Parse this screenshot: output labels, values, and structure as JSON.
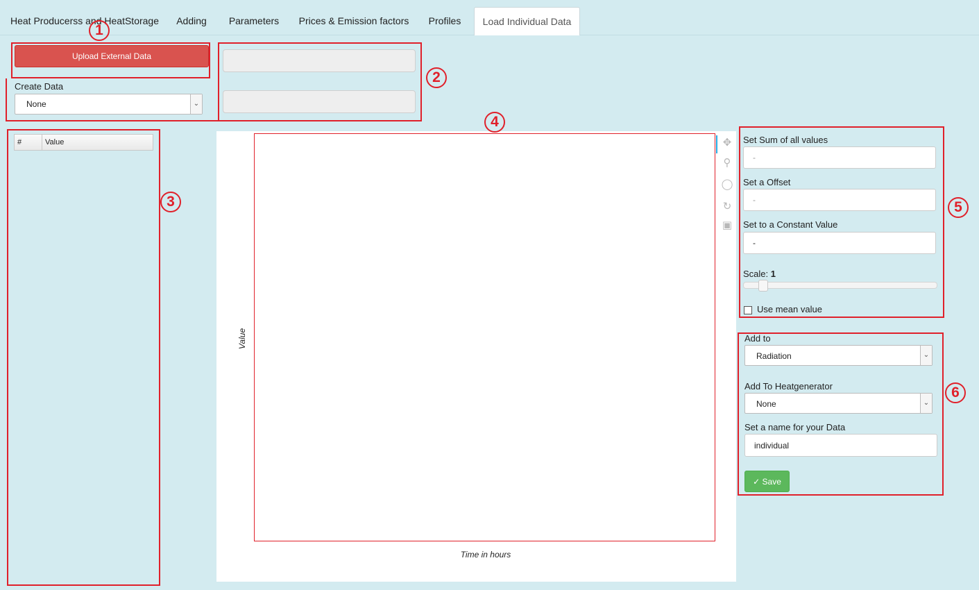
{
  "tabs": [
    {
      "label": "Heat Producerss and HeatStorage"
    },
    {
      "label": "Adding"
    },
    {
      "label": "Parameters"
    },
    {
      "label": "Prices & Emission factors"
    },
    {
      "label": "Profiles"
    },
    {
      "label": "Load Individual Data"
    }
  ],
  "upload": {
    "button_label": "Upload External Data"
  },
  "create": {
    "label": "Create Data",
    "selected": "None"
  },
  "table": {
    "headers": [
      "#",
      "Value"
    ]
  },
  "chart": {
    "ylabel": "Value",
    "xlabel": "Time in hours"
  },
  "chart_data": {
    "type": "line",
    "series": [],
    "xlabel": "Time in hours",
    "ylabel": "Value"
  },
  "toolbar": {
    "icons": [
      "pan-icon",
      "box-zoom-icon",
      "wheel-zoom-icon",
      "reset-icon",
      "save-icon"
    ]
  },
  "settings": {
    "sum_label": "Set Sum of all values",
    "sum_placeholder": "-",
    "offset_label": "Set a Offset",
    "offset_placeholder": "-",
    "constant_label": "Set to a Constant Value",
    "constant_value": "-",
    "scale_label": "Scale:",
    "scale_value": "1",
    "mean_label": "Use mean value"
  },
  "target": {
    "addto_label": "Add to",
    "addto_selected": "Radiation",
    "heatgen_label": "Add To Heatgenerator",
    "heatgen_selected": "None",
    "name_label": "Set a name for your Data",
    "name_value": "individual",
    "save_label": "✓ Save"
  },
  "annotations": [
    "1",
    "2",
    "3",
    "4",
    "5",
    "6"
  ],
  "colors": {
    "annotation": "#e0202a",
    "background": "#d3ebf0",
    "upload": "#d9534f",
    "save": "#5cb85c"
  }
}
